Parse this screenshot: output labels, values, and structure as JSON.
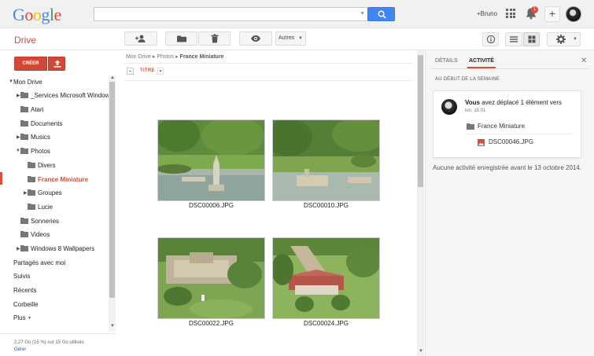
{
  "header": {
    "logo": "Google",
    "search": {
      "value": "",
      "placeholder": ""
    },
    "user": "+Bruno",
    "notifications": "1"
  },
  "toolbar": {
    "app_title": "Drive",
    "more_label": "Autres"
  },
  "sidebar": {
    "create_label": "CRÉER",
    "items": [
      {
        "label": "Mon Drive"
      },
      {
        "label": "_Services Microsoft Windows"
      },
      {
        "label": "Atari"
      },
      {
        "label": "Documents"
      },
      {
        "label": "Musics"
      },
      {
        "label": "Photos"
      },
      {
        "label": "Divers"
      },
      {
        "label": "France Miniature"
      },
      {
        "label": "Groupes"
      },
      {
        "label": "Lucie"
      },
      {
        "label": "Sonneries"
      },
      {
        "label": "Videos"
      },
      {
        "label": "Windows 8 Wallpapers"
      },
      {
        "label": "Partagés avec moi"
      },
      {
        "label": "Suivis"
      },
      {
        "label": "Récents"
      },
      {
        "label": "Corbeille"
      },
      {
        "label": "Plus"
      }
    ],
    "storage_text": "2,27 Go (15 %) sur 15 Go utilisés",
    "manage_link": "Gérer"
  },
  "main": {
    "breadcrumb": [
      "Mon Drive",
      "Photos",
      "France Miniature"
    ],
    "sort_label": "TITRE",
    "files": [
      {
        "name": "DSC00006.JPG"
      },
      {
        "name": "DSC00010.JPG"
      },
      {
        "name": "DSC00022.JPG"
      },
      {
        "name": "DSC00024.JPG"
      }
    ]
  },
  "details": {
    "tabs": [
      "DÉTAILS",
      "ACTIVITÉ"
    ],
    "section_label": "AU DÉBUT DE LA SEMAINE",
    "activity": {
      "actor": "Vous",
      "action": "avez déplacé 1 élément vers",
      "time": "lun. 15:01",
      "folder": "France Miniature",
      "file": "DSC00046.JPG"
    },
    "no_activity": "Aucune activité enregistrée avant le 13 octobre 2014."
  },
  "colors": {
    "brand_red": "#dd4b39",
    "search_blue": "#4285f4",
    "link_blue": "#1155cc"
  },
  "icons": [
    "search-icon",
    "apps-icon",
    "bell-icon",
    "add-person-icon",
    "folder-icon",
    "trash-icon",
    "eye-icon",
    "info-icon",
    "list-view-icon",
    "grid-view-icon",
    "gear-icon",
    "upload-icon",
    "close-icon"
  ]
}
